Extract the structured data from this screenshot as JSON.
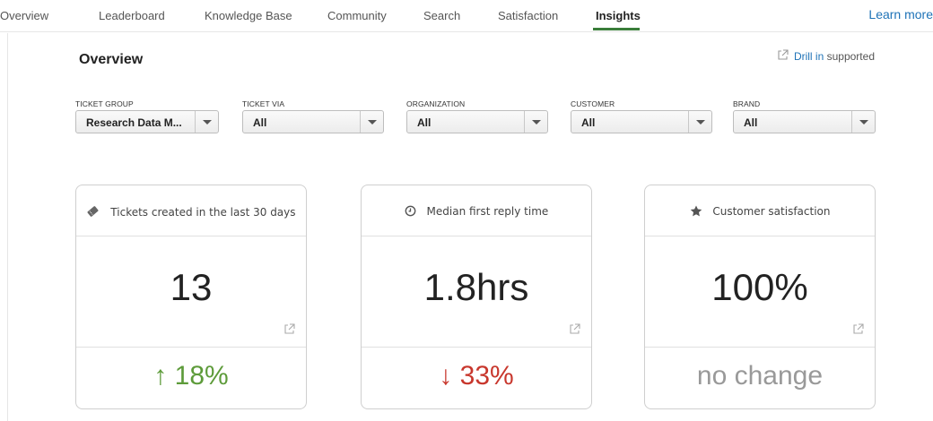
{
  "nav": {
    "tabs": [
      {
        "label": "Overview"
      },
      {
        "label": "Leaderboard"
      },
      {
        "label": "Knowledge Base"
      },
      {
        "label": "Community"
      },
      {
        "label": "Search"
      },
      {
        "label": "Satisfaction"
      },
      {
        "label": "Insights",
        "active": true
      }
    ],
    "learn_more": "Learn more"
  },
  "header": {
    "title": "Overview",
    "drill_link": "Drill in",
    "drill_suffix": " supported",
    "drill_icon": "external-link-icon"
  },
  "filters": [
    {
      "label": "TICKET GROUP",
      "value": "Research Data M..."
    },
    {
      "label": "TICKET VIA",
      "value": "All"
    },
    {
      "label": "ORGANIZATION",
      "value": "All"
    },
    {
      "label": "CUSTOMER",
      "value": "All"
    },
    {
      "label": "BRAND",
      "value": "All"
    }
  ],
  "cards": [
    {
      "title": "Tickets created in the last 30 days",
      "icon": "ticket-icon",
      "value": "13",
      "delta": "↑ 18%",
      "delta_status": "up"
    },
    {
      "title": "Median first reply time",
      "icon": "clock-icon",
      "value": "1.8hrs",
      "delta": "↓ 33%",
      "delta_status": "down"
    },
    {
      "title": "Customer satisfaction",
      "icon": "star-icon",
      "value": "100%",
      "delta": "no change",
      "delta_status": "none"
    }
  ],
  "colors": {
    "accent_link": "#1f73b7",
    "tab_underline": "#3a7d3a",
    "delta_up": "#5d9b3a",
    "delta_down": "#c8372d",
    "delta_none": "#999999"
  }
}
